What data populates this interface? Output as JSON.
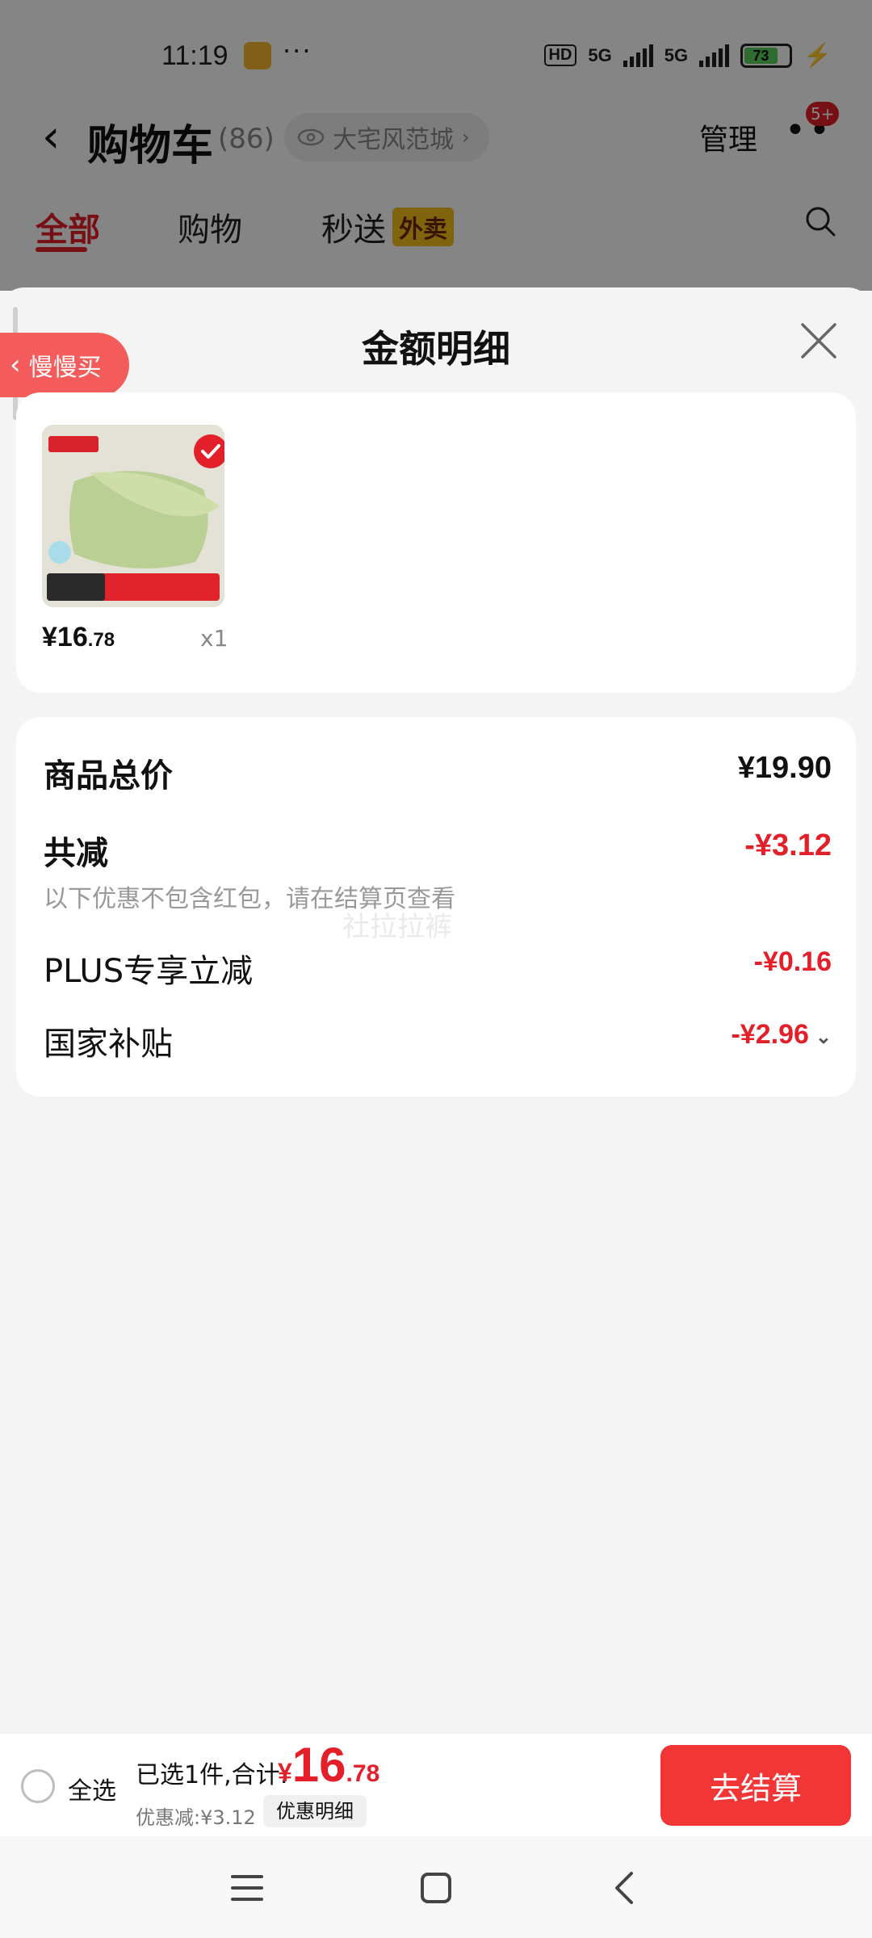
{
  "status_bar": {
    "time": "11:19",
    "dots": "···",
    "hd_label": "HD",
    "net1": "5G",
    "net2": "5G",
    "battery": "73"
  },
  "header": {
    "title": "购物车",
    "count": "(86)",
    "store": "大宅风范城",
    "manage": "管理",
    "badge": "5+"
  },
  "tabs": [
    {
      "label": "全部"
    },
    {
      "label": "购物"
    },
    {
      "label": "秒送"
    }
  ],
  "tab_tag": "外卖",
  "sheet": {
    "title": "金额明细",
    "slow_buy": "慢慢买",
    "item": {
      "price_int": "¥16",
      "price_dec": ".78",
      "qty": "x1"
    },
    "rows": {
      "total_label": "商品总价",
      "total_value": "¥19.90",
      "reduce_label": "共减",
      "reduce_value": "-¥3.12",
      "reduce_note": "以下优惠不包含红包，请在结算页查看",
      "plus_label": "PLUS专享立减",
      "plus_value": "-¥0.16",
      "subsidy_label": "国家补贴",
      "subsidy_value": "-¥2.96"
    },
    "watermark": "社拉拉裤"
  },
  "bottom": {
    "select_all": "全选",
    "summary": "已选1件,合计:",
    "total_cur": "¥",
    "total_int": "16",
    "total_dec": ".78",
    "discount": "优惠减:¥3.12",
    "detail_chip": "优惠明细",
    "checkout": "去结算"
  },
  "colors": {
    "accent_red": "#e3202a",
    "checkout_red": "#f23535"
  }
}
